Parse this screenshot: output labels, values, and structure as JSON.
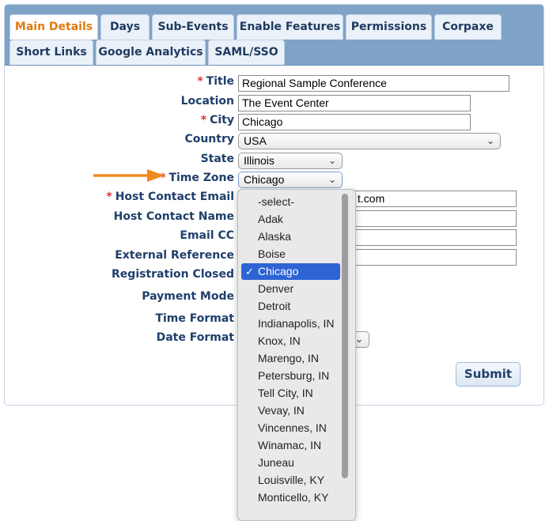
{
  "tabs": [
    {
      "label": "Main Details",
      "active": true
    },
    {
      "label": "Days"
    },
    {
      "label": "Sub-Events"
    },
    {
      "label": "Enable Features"
    },
    {
      "label": "Permissions"
    },
    {
      "label": "Corpaxe"
    },
    {
      "label": "Short Links"
    },
    {
      "label": "Google Analytics"
    },
    {
      "label": "SAML/SSO"
    }
  ],
  "form": {
    "required_marker": "*",
    "title": {
      "label": "Title",
      "value": "Regional Sample Conference"
    },
    "location": {
      "label": "Location",
      "value": "The Event Center"
    },
    "city": {
      "label": "City",
      "value": "Chicago"
    },
    "country": {
      "label": "Country",
      "value": "USA"
    },
    "state": {
      "label": "State",
      "value": "Illinois"
    },
    "time_zone": {
      "label": "Time Zone",
      "value": "Chicago"
    },
    "host_contact_email": {
      "label": "Host Contact Email",
      "visible_value": "t.com"
    },
    "host_contact_name": {
      "label": "Host Contact Name"
    },
    "email_cc": {
      "label": "Email CC"
    },
    "external_reference": {
      "label": "External Reference"
    },
    "registration_closed": {
      "label": "Registration Closed"
    },
    "payment_mode": {
      "label": "Payment Mode"
    },
    "time_format": {
      "label": "Time Format"
    },
    "date_format": {
      "label": "Date Format"
    },
    "submit_label": "Submit"
  },
  "timezone_options": [
    "-select-",
    "Adak",
    "Alaska",
    "Boise",
    "Chicago",
    "Denver",
    "Detroit",
    "Indianapolis, IN",
    "Knox, IN",
    "Marengo, IN",
    "Petersburg, IN",
    "Tell City, IN",
    "Vevay, IN",
    "Vincennes, IN",
    "Winamac, IN",
    "Juneau",
    "Louisville, KY",
    "Monticello, KY"
  ],
  "timezone_selected": "Chicago",
  "icons": {
    "check": "✓",
    "chevron": "chevron-down-icon"
  },
  "colors": {
    "accent": "#e07a10",
    "tabbar": "#7ea3c7",
    "selection": "#2e63d4",
    "required": "#e03030"
  }
}
